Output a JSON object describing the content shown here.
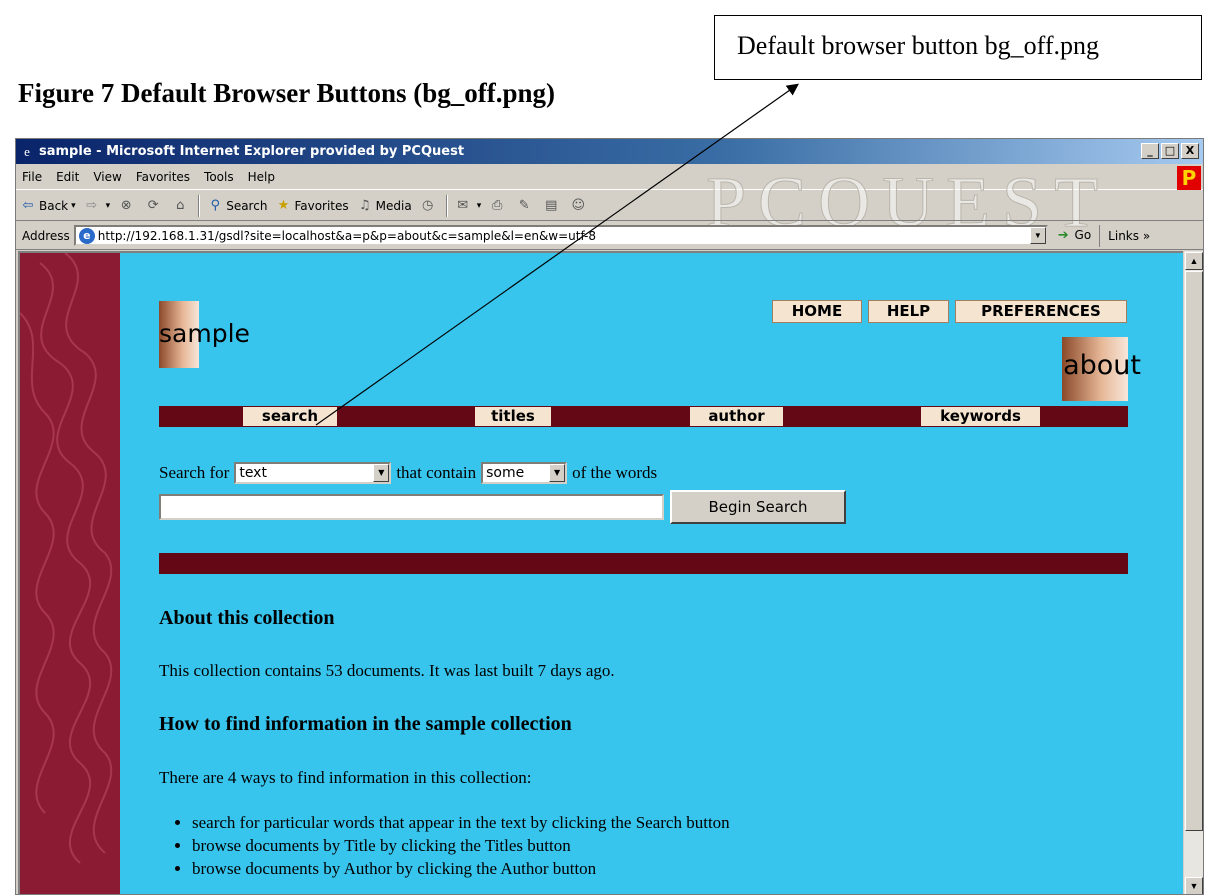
{
  "figure": {
    "caption": "Figure 7 Default Browser Buttons (bg_off.png)",
    "callout": "Default browser button bg_off.png"
  },
  "browser": {
    "title": "sample - Microsoft Internet Explorer provided by PCQuest",
    "window_controls": [
      "_",
      "□",
      "X"
    ],
    "menu": [
      "File",
      "Edit",
      "View",
      "Favorites",
      "Tools",
      "Help"
    ],
    "brand_letter": "P",
    "watermark": "PCQUEST",
    "toolbar": {
      "back": "Back",
      "search": "Search",
      "favorites": "Favorites",
      "media": "Media"
    },
    "address": {
      "label": "Address",
      "url": "http://192.168.1.31/gsdl?site=localhost&a=p&p=about&c=sample&l=en&w=utf-8",
      "go": "Go",
      "links": "Links »"
    }
  },
  "page": {
    "collection_name": "sample",
    "page_title": "about",
    "top_nav": [
      "HOME",
      "HELP",
      "PREFERENCES"
    ],
    "nav_bar": [
      "search",
      "titles",
      "author",
      "keywords"
    ],
    "search": {
      "label_for": "Search for",
      "field_select": "text",
      "label_contain": "that contain",
      "mode_select": "some",
      "label_words": "of the words",
      "query_value": "",
      "button": "Begin Search"
    },
    "about_heading": "About this collection",
    "about_text": "This collection contains 53 documents. It was last built 7 days ago.",
    "howto_heading": "How to find information in the sample collection",
    "howto_intro": "There are 4 ways to find information in this collection:",
    "bullets": [
      "search for particular words that appear in the text by clicking the Search button",
      "browse documents by Title by clicking the Titles button",
      "browse documents by Author by clicking the Author button"
    ]
  },
  "colors": {
    "page_background": "#37c5ee",
    "nav_strip": "#640815",
    "button_face": "#f5e5d0",
    "sidebar": "#8b1a33",
    "titlebar": "#0a246a"
  }
}
